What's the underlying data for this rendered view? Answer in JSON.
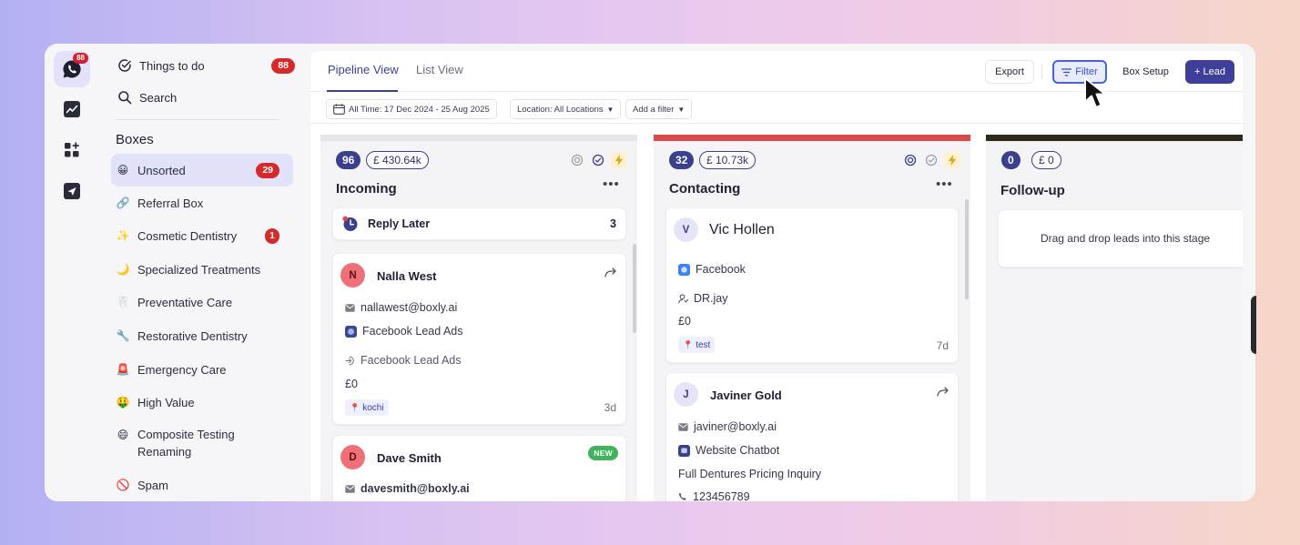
{
  "rail": {
    "items": [
      {
        "icon": "chat-bubble-icon",
        "badge": "88"
      },
      {
        "icon": "trend-chart-icon"
      },
      {
        "icon": "apps-grid-plus-icon"
      },
      {
        "icon": "send-arrow-icon"
      }
    ]
  },
  "sidebar": {
    "things_to_do": {
      "label": "Things to do",
      "count": "88"
    },
    "search": {
      "label": "Search"
    },
    "boxes_heading": "Boxes",
    "boxes": [
      {
        "label": "Unsorted",
        "emoji": "😀",
        "count": "29",
        "selected": true
      },
      {
        "label": "Referral Box",
        "emoji": "🔗"
      },
      {
        "label": "Cosmetic Dentistry",
        "emoji": "✨",
        "count": "1"
      },
      {
        "label": "Specialized Treatments",
        "emoji": "🌙"
      },
      {
        "label": "Preventative Care",
        "emoji": "🦷"
      },
      {
        "label": "Restorative Dentistry",
        "emoji": "🔧"
      },
      {
        "label": "Emergency Care",
        "emoji": "🚨"
      },
      {
        "label": "High Value",
        "emoji": "🤑"
      },
      {
        "label": "Composite Testing",
        "label2": "Renaming",
        "emoji": "😄"
      },
      {
        "label": "Spam",
        "emoji": "🚫"
      }
    ]
  },
  "header": {
    "tabs": [
      {
        "label": "Pipeline View",
        "active": true
      },
      {
        "label": "List View",
        "active": false
      }
    ],
    "buttons": {
      "export": "Export",
      "filter": "Filter",
      "box_setup": "Box Setup",
      "lead": "+ Lead"
    }
  },
  "filters": {
    "date": "All Time: 17 Dec 2024 - 25 Aug 2025",
    "location": "Location: All Locations",
    "add": "Add a filter"
  },
  "columns": [
    {
      "title": "Incoming",
      "count": "96",
      "amount": "£ 430.64k",
      "bar_color": "#e5e5ea",
      "reply_later": {
        "label": "Reply Later",
        "count": "3"
      },
      "cards": [
        {
          "initial": "N",
          "name": "Nalla West",
          "email": "nallawest@boxly.ai",
          "source": "Facebook Lead Ads",
          "form": "Facebook Lead Ads",
          "value": "£0",
          "tag": "kochi",
          "age": "3d"
        },
        {
          "initial": "D",
          "name": "Dave Smith",
          "new": "NEW",
          "email": "davesmith@boxly.ai"
        }
      ]
    },
    {
      "title": "Contacting",
      "count": "32",
      "amount": "£ 10.73k",
      "bar_color": "#d94a4a",
      "cards": [
        {
          "initial": "V",
          "name": "Vic Hollen",
          "source": "Facebook",
          "owner": "DR.jay",
          "value": "£0",
          "tag": "test",
          "age": "7d"
        },
        {
          "initial": "J",
          "name": "Javiner Gold",
          "email": "javiner@boxly.ai",
          "source": "Website Chatbot",
          "note": "Full Dentures Pricing Inquiry",
          "phone": "123456789"
        }
      ]
    },
    {
      "title": "Follow-up",
      "count": "0",
      "amount": "£ 0",
      "bar_color": "#2e2a1e",
      "empty": "Drag and drop leads into this stage"
    }
  ],
  "colors": {
    "accent": "#3b3f8c",
    "badge_red": "#d62a2a",
    "filter_active": "#4a62d8"
  }
}
